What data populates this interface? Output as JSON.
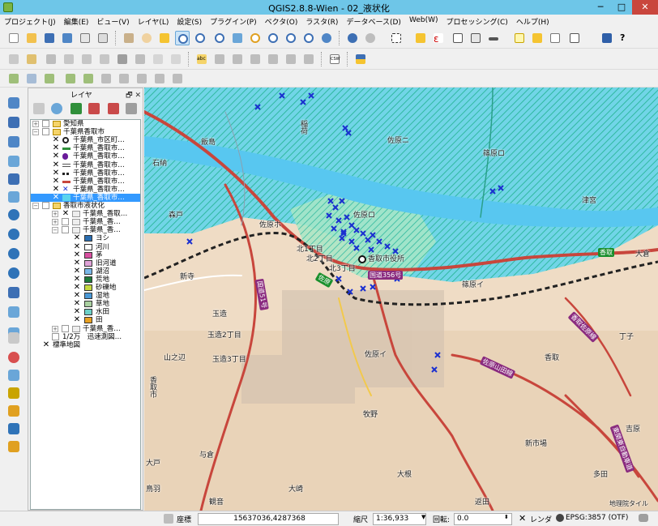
{
  "window": {
    "title": "QGIS2.8.8-Wien - 02_液状化",
    "min": "─",
    "max": "□",
    "close": "✕"
  },
  "menu": [
    "プロジェクト(J)",
    "編集(E)",
    "ビュー(V)",
    "レイヤ(L)",
    "設定(S)",
    "プラグイン(P)",
    "ベクタ(O)",
    "ラスタ(R)",
    "データベース(D)",
    "Web(W)",
    "プロセッシング(C)",
    "ヘルプ(H)"
  ],
  "layer_panel": {
    "title": "レイヤ",
    "header_buttons": "🗗 ✕",
    "tree": [
      {
        "label": "愛知県",
        "indent": 0,
        "checked": false,
        "expander": "+",
        "type": "group"
      },
      {
        "label": "千葉県香取市",
        "indent": 0,
        "checked": false,
        "expander": "−",
        "type": "group"
      },
      {
        "label": "千葉県_市区町…",
        "indent": 1,
        "checked": true,
        "symbol": "circle-outline"
      },
      {
        "label": "千葉県_香取市…",
        "indent": 1,
        "checked": true,
        "symbol": "green-line"
      },
      {
        "label": "千葉県_香取市…",
        "indent": 1,
        "checked": true,
        "symbol": "purple-dot"
      },
      {
        "label": "千葉県_香取市…",
        "indent": 1,
        "checked": true,
        "symbol": "double-line"
      },
      {
        "label": "千葉県_香取市…",
        "indent": 1,
        "checked": true,
        "symbol": "railway"
      },
      {
        "label": "千葉県_香取市…",
        "indent": 1,
        "checked": true,
        "symbol": "red-line"
      },
      {
        "label": "千葉県_香取市…",
        "indent": 1,
        "checked": true,
        "symbol": "blue-x"
      },
      {
        "label": "千葉県_香取市…",
        "indent": 1,
        "checked": true,
        "symbol": "hatch",
        "selected": true
      },
      {
        "label": "香取市液状化",
        "indent": 0,
        "checked": false,
        "expander": "−",
        "type": "group"
      },
      {
        "label": "千葉県_香取…",
        "indent": 2,
        "checked": true,
        "expander": "+",
        "symbol": "polygon"
      },
      {
        "label": "千葉県_香…",
        "indent": 2,
        "checked": false,
        "expander": "+",
        "symbol": "polygon"
      },
      {
        "label": "千葉県_香…",
        "indent": 2,
        "checked": false,
        "expander": "−",
        "symbol": "polygon"
      }
    ],
    "legend": [
      {
        "label": "ヨシ",
        "color": "#2a6db0"
      },
      {
        "label": "河川",
        "color": "#ffffff"
      },
      {
        "label": "茅",
        "color": "#d84fa0"
      },
      {
        "label": "旧河道",
        "color": "#e0a3d8"
      },
      {
        "label": "湖沼",
        "color": "#7ab8e8"
      },
      {
        "label": "荒地",
        "color": "#1f7a3a"
      },
      {
        "label": "砂礫地",
        "color": "#c6d940"
      },
      {
        "label": "湿地",
        "color": "#4a98d6"
      },
      {
        "label": "草地",
        "color": "#a9d0a0"
      },
      {
        "label": "水田",
        "color": "#6dd0c7"
      },
      {
        "label": "田",
        "color": "#e8a020"
      }
    ],
    "tail": [
      {
        "label": "千葉県_香…",
        "indent": 2,
        "checked": false,
        "expander": "+",
        "symbol": "polygon"
      },
      {
        "label": "1/2万　迅速測図…",
        "indent": 1,
        "checked": false
      },
      {
        "label": "標準地図",
        "indent": 0,
        "checked": true
      }
    ]
  },
  "map": {
    "place_labels": [
      "飯島",
      "石納",
      "佐原ニ",
      "篠原ロ",
      "津宮",
      "森戸",
      "佐原ホ",
      "佐原ロ",
      "新寺",
      "北1丁目",
      "北2丁目",
      "北3丁目",
      "香取市役所",
      "篠原イ",
      "玉造",
      "玉造2丁目",
      "玉造3丁目",
      "山之辺",
      "佐原イ",
      "香取",
      "丁子",
      "牧野",
      "新市場",
      "吉原",
      "与倉",
      "大根",
      "多田",
      "返田",
      "大崎",
      "観音",
      "大倉",
      "鳥羽",
      "大戸",
      "香取市",
      "稲荷"
    ],
    "road_labels": [
      "国道356号",
      "国道51号",
      "佐原山田線",
      "香取佐原線",
      "東関東自動車道"
    ],
    "green_labels": [
      "佐原",
      "香取"
    ],
    "attribution": "地理院タイル"
  },
  "status": {
    "coord_label": "座標",
    "coord_value": "15637036,4287368",
    "scale_label": "縮尺",
    "scale_value": "1:36,933",
    "rotation_label": "回転:",
    "rotation_value": "0.0",
    "render_label": "レンダ",
    "render_checked": true,
    "crs": "EPSG:3857 (OTF)"
  }
}
